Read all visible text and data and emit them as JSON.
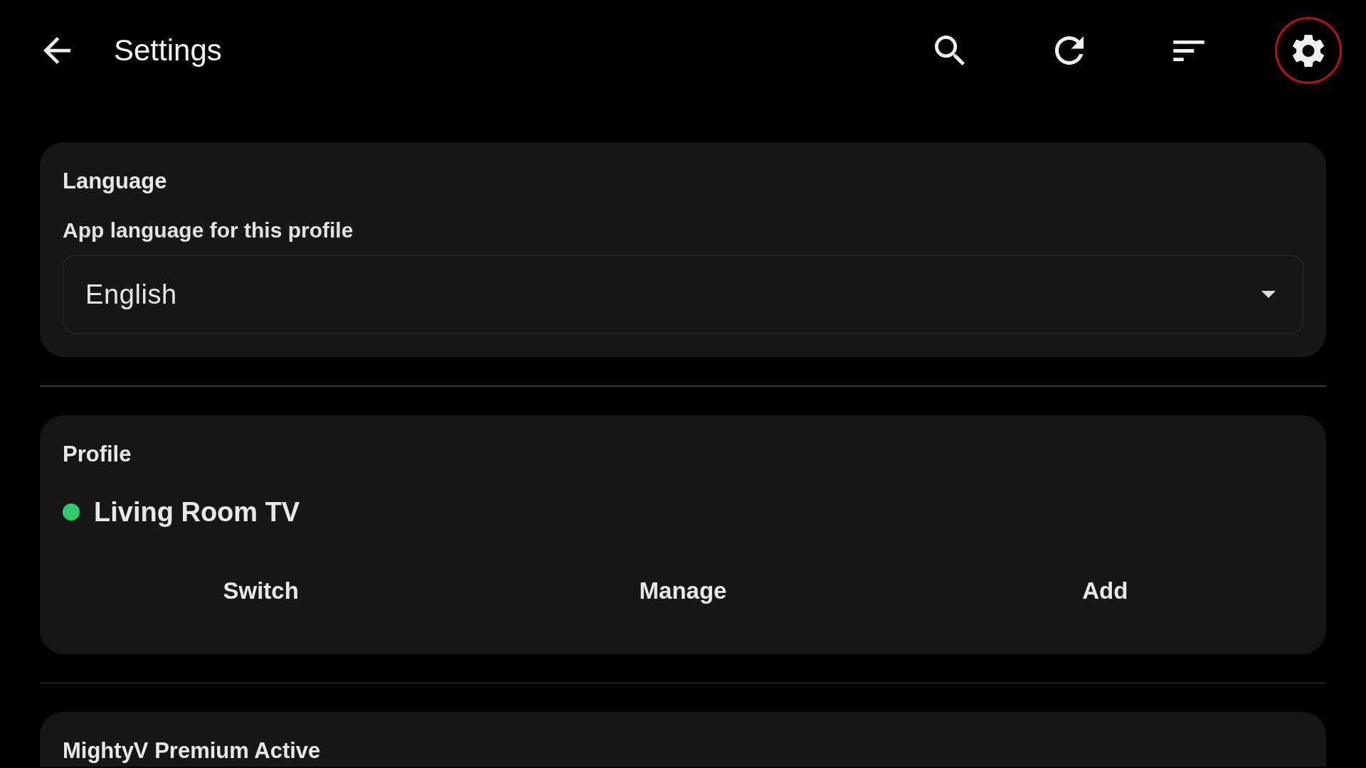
{
  "top_bar": {
    "title": "Settings",
    "actions": [
      {
        "focused": false
      },
      {
        "focused": false
      },
      {
        "focused": false
      },
      {
        "focused": true
      }
    ]
  },
  "language": {
    "title": "Language",
    "label": "App language for this profile",
    "dropdown": {
      "value": "English"
    }
  },
  "profile": {
    "title": "Profile",
    "current": {
      "name": "Living Room TV",
      "active": true
    },
    "buttons": [
      "Switch",
      "Manage",
      "Add"
    ]
  },
  "premium": {
    "title": "MightyV Premium Active"
  }
}
